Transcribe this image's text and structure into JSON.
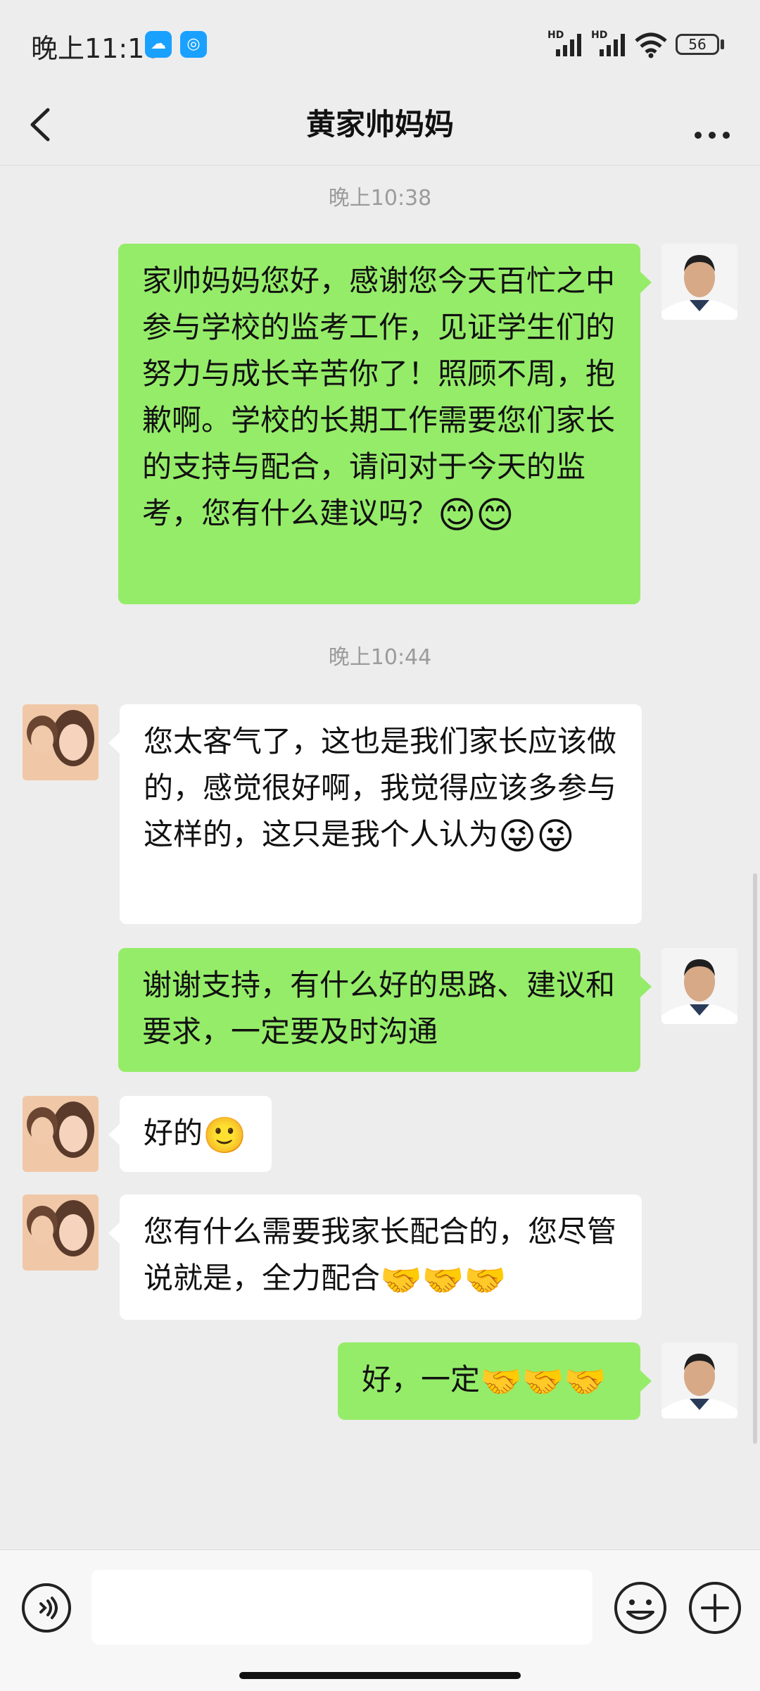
{
  "status_bar": {
    "time": "晚上11:10",
    "signal_label_1": "HD",
    "signal_label_2": "HD",
    "battery": "56"
  },
  "header": {
    "title": "黄家帅妈妈"
  },
  "chat": {
    "timestamps": [
      "晚上10:38",
      "晚上10:44"
    ],
    "messages": [
      {
        "sender": "me",
        "text": "家帅妈妈您好，感谢您今天百忙之中参与学校的监考工作，见证学生们的努力与成长辛苦你了！照顾不周，抱歉啊。学校的长期工作需要您们家长的支持与配合，请问对于今天的监考，您有什么建议吗？",
        "emoji": "😊😊"
      },
      {
        "sender": "other",
        "text": "您太客气了，这也是我们家长应该做的，感觉很好啊，我觉得应该多参与这样的，这只是我个人认为",
        "emoji": "😜😜"
      },
      {
        "sender": "me",
        "text": "谢谢支持，有什么好的思路、建议和要求，一定要及时沟通",
        "emoji": ""
      },
      {
        "sender": "other",
        "text": "好的",
        "emoji": "🙂"
      },
      {
        "sender": "other",
        "text": "您有什么需要我家长配合的，您尽管说就是，全力配合",
        "emoji": "🤝🤝🤝"
      },
      {
        "sender": "me",
        "text": "好，一定",
        "emoji": "🤝🤝🤝"
      }
    ]
  },
  "input_bar": {
    "placeholder": ""
  },
  "colors": {
    "my_bubble": "#95ec69",
    "other_bubble": "#ffffff",
    "background": "#ededed"
  },
  "icons": [
    "cloud-icon",
    "app-notify-icon",
    "signal-icon",
    "wifi-icon",
    "battery-icon",
    "back-arrow-icon",
    "more-dots-icon",
    "voice-icon",
    "emoji-icon",
    "plus-icon"
  ]
}
